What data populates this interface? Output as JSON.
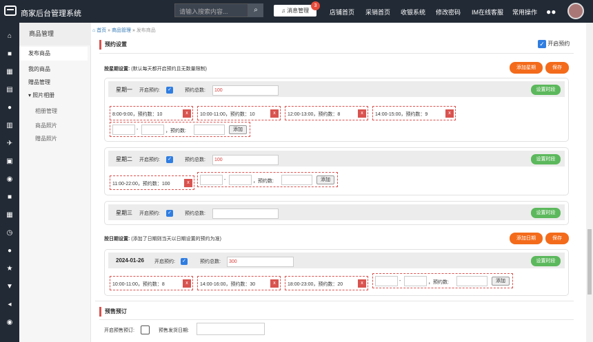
{
  "app_title": "商家后台管理系统",
  "search_placeholder": "请输入搜索内容...",
  "msg": {
    "label": "消息管理",
    "count": "3"
  },
  "nav": [
    "店铺首页",
    "采销首页",
    "收银系统",
    "修改密码",
    "IM在线客服",
    "常用操作"
  ],
  "menu": {
    "head": "商品管理",
    "items": [
      "发布商品",
      "我的商品",
      "赠品管理",
      "照片相册"
    ],
    "subs": [
      "相册管理",
      "商品照片",
      "赠品照片"
    ]
  },
  "breadcrumb": {
    "home": "首页",
    "sep": "»",
    "parent": "商品管理",
    "current": "发布商品"
  },
  "section1": {
    "title": "预约设置",
    "enable": "开启预约"
  },
  "week": {
    "label": "按星期设置:",
    "note": "(默认每天都开启预约且无数量限制)",
    "add": "添加星期",
    "save": "保存"
  },
  "labels": {
    "open": "开启预约:",
    "total": "预约总数:",
    "set_time": "设置时段",
    "count": "，预约数:",
    "add": "添加",
    "x": "x",
    "dash": "-"
  },
  "days": [
    {
      "name": "星期一",
      "total": "100",
      "slots": [
        "8:00-9:00，预约数：10",
        "10:00-11:00，预约数：10",
        "12:00-13:00，预约数：8",
        "14:00-15:00，预约数：9"
      ]
    },
    {
      "name": "星期二",
      "total": "100",
      "slots": [
        "11:00-22:00，预约数：100"
      ]
    },
    {
      "name": "星期三",
      "total": "",
      "slots": []
    }
  ],
  "date": {
    "label": "按日期设置:",
    "note": "(添加了日期则当天以日期设置的预约为准)",
    "add": "添加日期",
    "save": "保存",
    "name": "2024-01-26",
    "total": "300",
    "slots": [
      "10:00-11:00，预约数：8",
      "14:00-16:00，预约数：30",
      "18:00-23:00，预约数：20"
    ]
  },
  "presale": {
    "title": "预售预订",
    "open": "开启预售预订:",
    "ship": "预售发货日期:"
  }
}
